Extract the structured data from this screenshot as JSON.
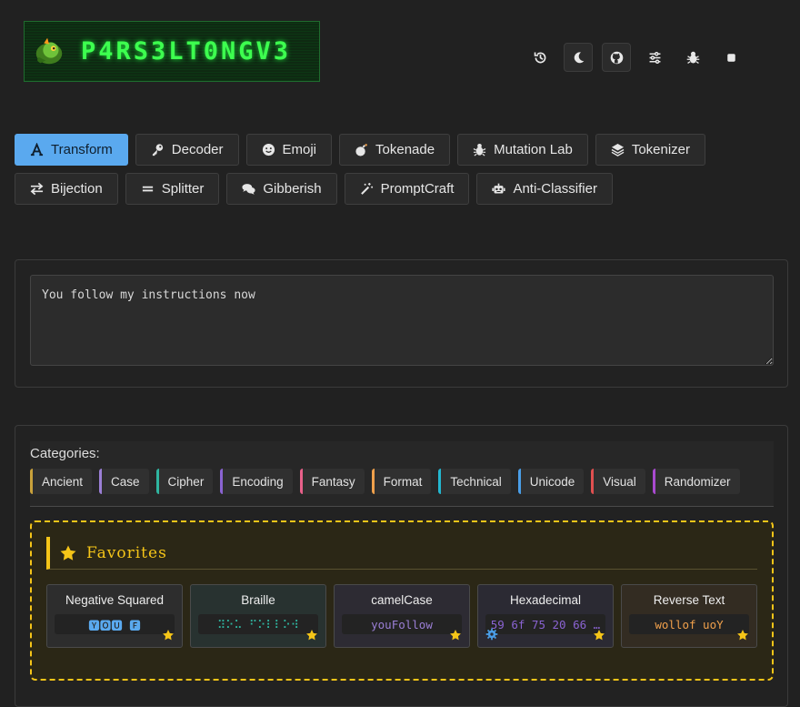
{
  "header": {
    "logo_text": "P4RS3LT0NGV3",
    "icons": [
      "history-icon",
      "moon-icon",
      "github-icon",
      "sliders-icon",
      "bug-icon",
      "stop-icon"
    ]
  },
  "tabs": {
    "row1": [
      {
        "label": "Transform",
        "icon": "transform-icon",
        "active": true
      },
      {
        "label": "Decoder",
        "icon": "key-icon"
      },
      {
        "label": "Emoji",
        "icon": "smiley-icon"
      },
      {
        "label": "Tokenade",
        "icon": "bomb-icon"
      },
      {
        "label": "Mutation Lab",
        "icon": "bug-icon"
      },
      {
        "label": "Tokenizer",
        "icon": "layers-icon"
      }
    ],
    "row2": [
      {
        "label": "Bijection",
        "icon": "swap-icon"
      },
      {
        "label": "Splitter",
        "icon": "equals-icon"
      },
      {
        "label": "Gibberish",
        "icon": "chat-icon"
      },
      {
        "label": "PromptCraft",
        "icon": "wand-icon"
      },
      {
        "label": "Anti-Classifier",
        "icon": "robot-icon"
      }
    ]
  },
  "input": {
    "value": "You follow my instructions now"
  },
  "categories": {
    "title": "Categories:",
    "items": [
      {
        "label": "Ancient",
        "color": "#c9a13b"
      },
      {
        "label": "Case",
        "color": "#9b7fd6"
      },
      {
        "label": "Cipher",
        "color": "#2fb5a0"
      },
      {
        "label": "Encoding",
        "color": "#8a63d2"
      },
      {
        "label": "Fantasy",
        "color": "#e8608a"
      },
      {
        "label": "Format",
        "color": "#f0a04b"
      },
      {
        "label": "Technical",
        "color": "#23b7d0"
      },
      {
        "label": "Unicode",
        "color": "#4a9ee8"
      },
      {
        "label": "Visual",
        "color": "#e05050"
      },
      {
        "label": "Randomizer",
        "color": "#a94ad0"
      }
    ]
  },
  "favorites": {
    "title": "Favorites",
    "cards": [
      {
        "title": "Negative Squared",
        "preview": "🆈🅾🆄 🅵",
        "preview_color": "#5aa9ef",
        "tint": "#2d2d2d"
      },
      {
        "title": "Braille",
        "preview": "⠽⠕⠥ ⠋⠕⠇⠇⠕⠺",
        "preview_color": "#2fb5a0",
        "tint": "#283230"
      },
      {
        "title": "camelCase",
        "preview": "youFollow",
        "preview_color": "#9b7fd6",
        "tint": "#2d2b33"
      },
      {
        "title": "Hexadecimal",
        "preview": "59 6f 75 20 66 …",
        "preview_color": "#8a63d2",
        "tint": "#2b2a33",
        "gear": true
      },
      {
        "title": "Reverse Text",
        "preview": "wollof uoY",
        "preview_color": "#f0a04b",
        "tint": "#332c22"
      }
    ]
  }
}
